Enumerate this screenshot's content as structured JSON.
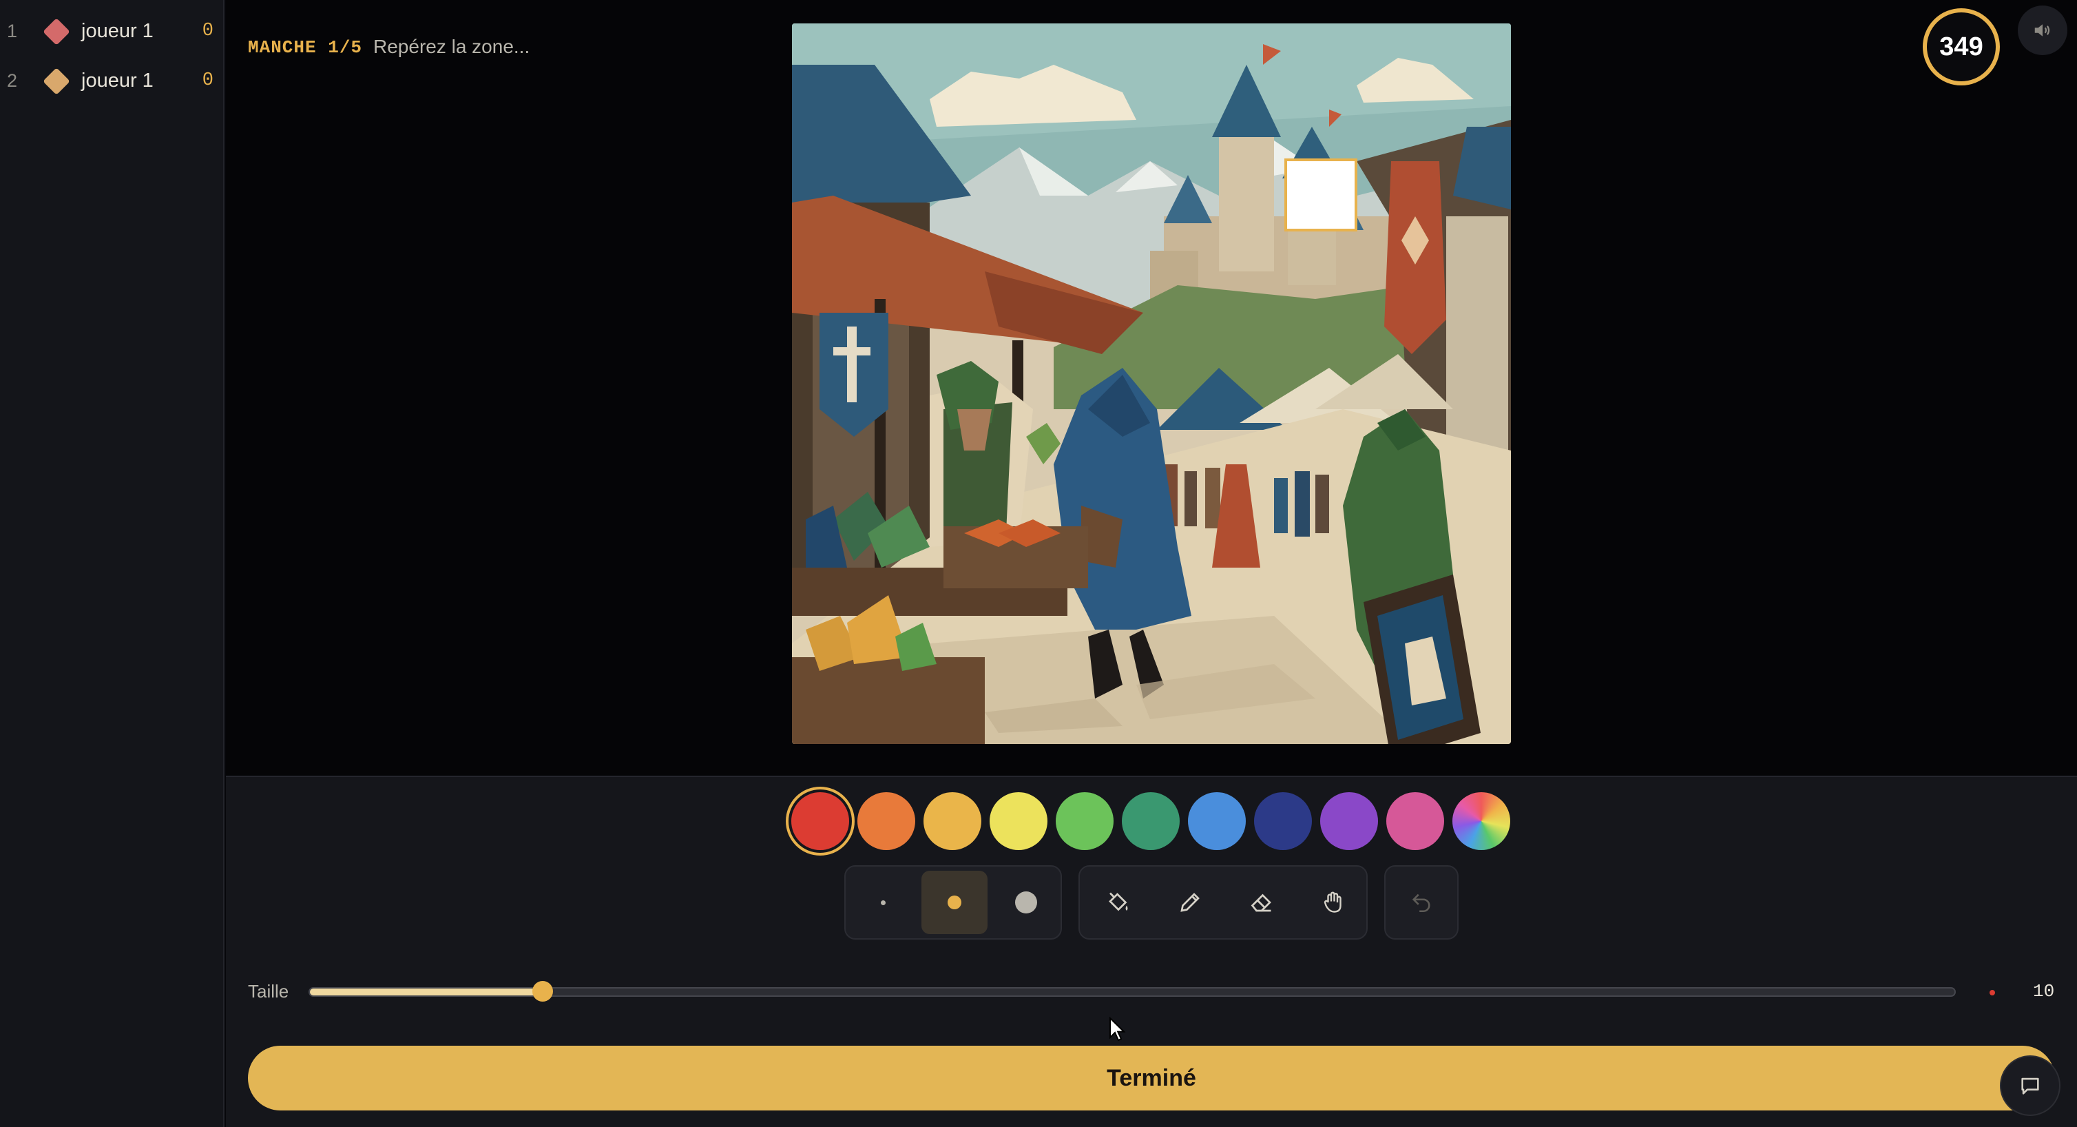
{
  "players": [
    {
      "rank": "1",
      "name": "joueur 1",
      "score": "0",
      "color": "#d46a6a"
    },
    {
      "rank": "2",
      "name": "joueur 1",
      "score": "0",
      "color": "#d9a86c"
    }
  ],
  "round": {
    "label": "MANCHE 1/5",
    "hint": "Repérez la zone..."
  },
  "timer": {
    "value": "349"
  },
  "palette": [
    {
      "name": "red",
      "color": "#dc3c32",
      "selected": true
    },
    {
      "name": "orange",
      "color": "#e87a3a"
    },
    {
      "name": "amber",
      "color": "#eab54a"
    },
    {
      "name": "yellow",
      "color": "#ece25c"
    },
    {
      "name": "green",
      "color": "#6cc35a"
    },
    {
      "name": "teal",
      "color": "#3a9870"
    },
    {
      "name": "blue",
      "color": "#4a8edc"
    },
    {
      "name": "navy",
      "color": "#2c3a88"
    },
    {
      "name": "purple",
      "color": "#8a48c8"
    },
    {
      "name": "pink",
      "color": "#d65898"
    },
    {
      "name": "rainbow",
      "color": "multicolor"
    }
  ],
  "brush_sizes": [
    "small",
    "medium",
    "large"
  ],
  "active_brush_size": "medium",
  "tools": [
    "bucket-icon",
    "pencil-icon",
    "eraser-icon",
    "hand-icon"
  ],
  "size_slider": {
    "label": "Taille",
    "value": 10,
    "fraction": 0.142
  },
  "done_button": {
    "label": "Terminé"
  },
  "colors": {
    "accent": "#e8b24c",
    "done_button": "#e3b655",
    "sidebar_bg": "#14151a",
    "panel_bg": "#15161b"
  }
}
